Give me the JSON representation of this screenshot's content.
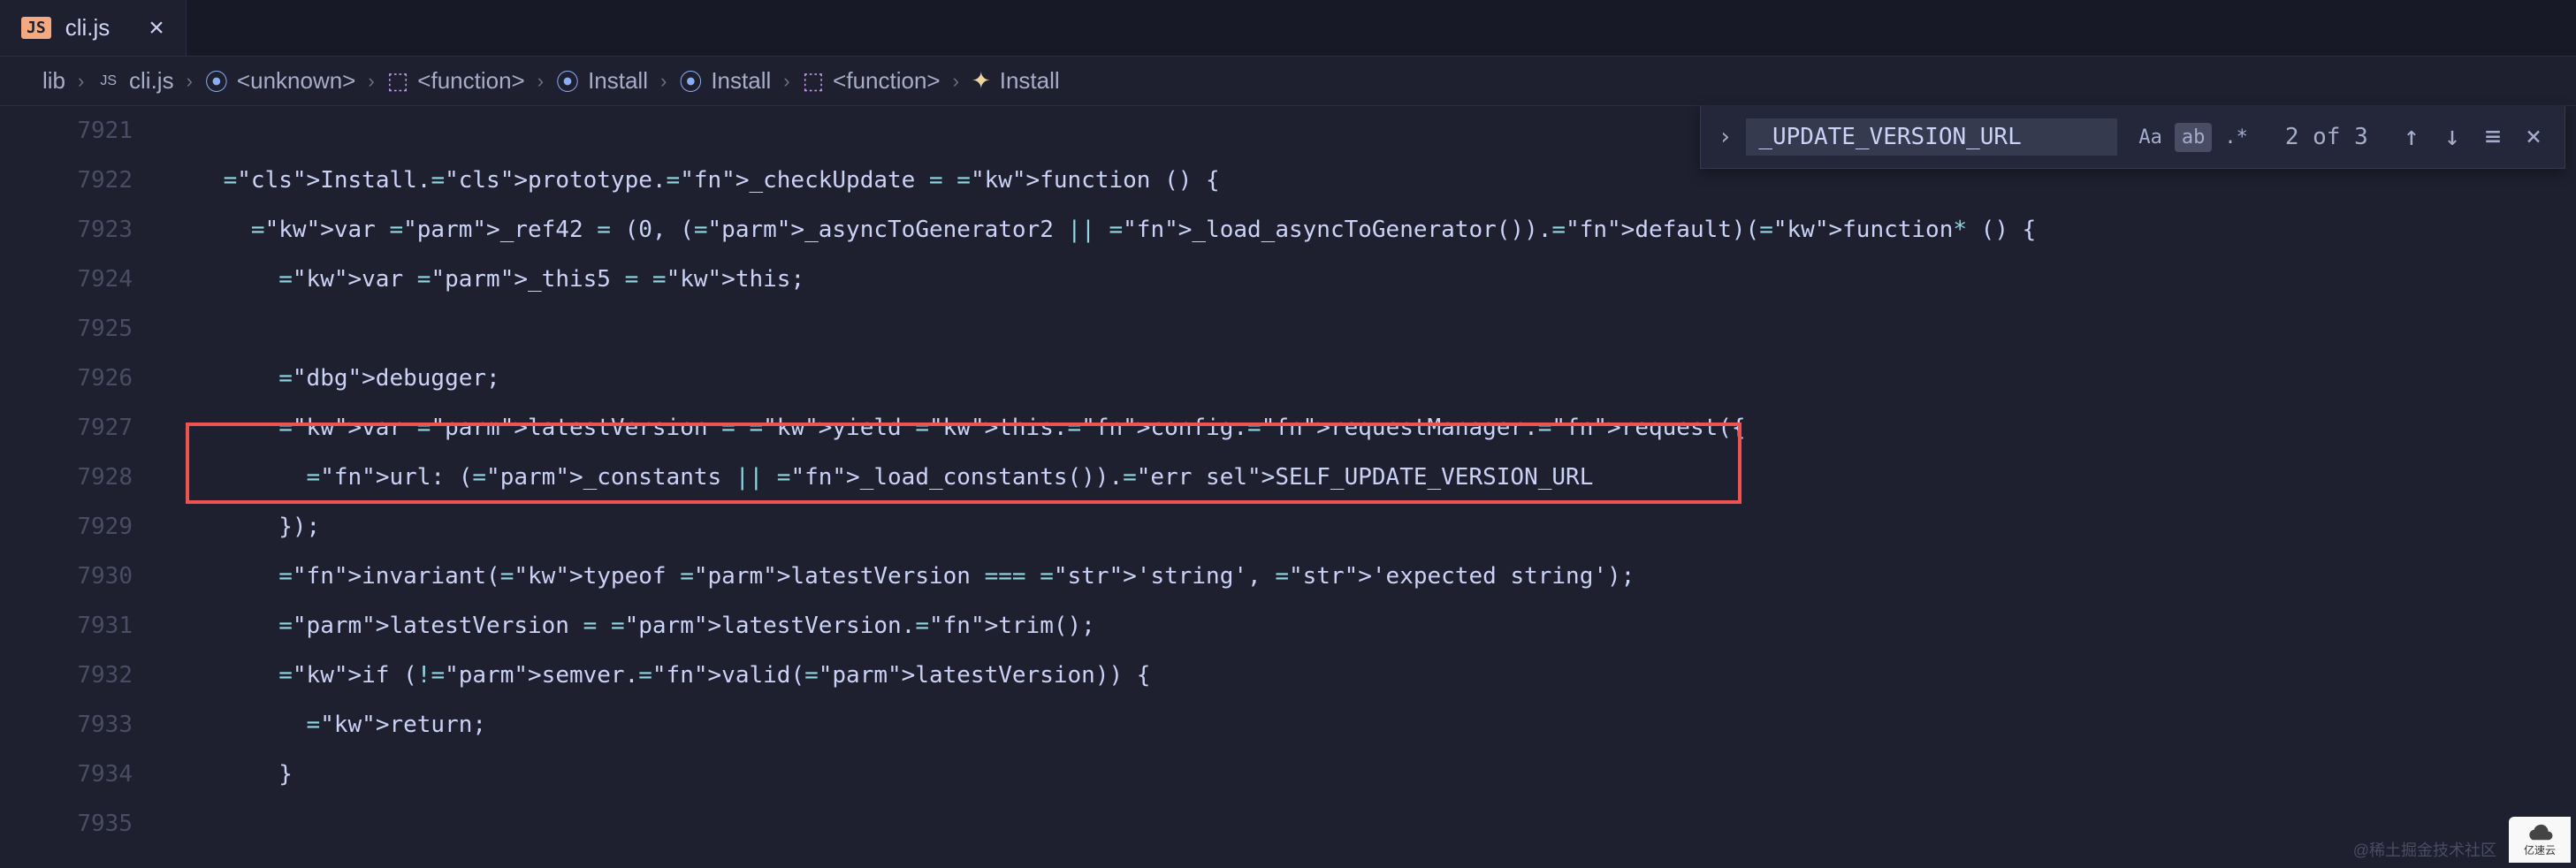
{
  "tabs": [
    {
      "icon": "JS",
      "label": "cli.js"
    }
  ],
  "breadcrumbs": {
    "items": [
      {
        "label": "lib",
        "icon": ""
      },
      {
        "label": "cli.js",
        "icon": "js"
      },
      {
        "label": "<unknown>",
        "icon": "brackets"
      },
      {
        "label": "<function>",
        "icon": "cube"
      },
      {
        "label": "Install",
        "icon": "brackets"
      },
      {
        "label": "Install",
        "icon": "brackets"
      },
      {
        "label": "<function>",
        "icon": "cube"
      },
      {
        "label": "Install",
        "icon": "wand"
      }
    ]
  },
  "find": {
    "query": "_UPDATE_VERSION_URL",
    "match_case": "Aa",
    "whole_word": "ab",
    "regex": ".*",
    "count": "2 of 3"
  },
  "gutter_start": 7921,
  "gutter_end": 7935,
  "code": {
    "lines": [
      "",
      "Install.prototype._checkUpdate = function () {",
      "  var _ref42 = (0, (_asyncToGenerator2 || _load_asyncToGenerator()).default)(function* () {",
      "    var _this5 = this;",
      "",
      "    debugger;",
      "    var latestVersion = yield this.config.requestManager.request({",
      "      url: (_constants || _load_constants()).SELF_UPDATE_VERSION_URL",
      "    });",
      "    invariant(typeof latestVersion === 'string', 'expected string');",
      "    latestVersion = latestVersion.trim();",
      "    if (!semver.valid(latestVersion)) {",
      "      return;",
      "    }",
      ""
    ],
    "highlight_line_index": 7,
    "selected_token": "SELF_UPDATE_VERSION_URL"
  },
  "watermark": "@稀土掘金技术社区",
  "cloud_label": "亿速云"
}
